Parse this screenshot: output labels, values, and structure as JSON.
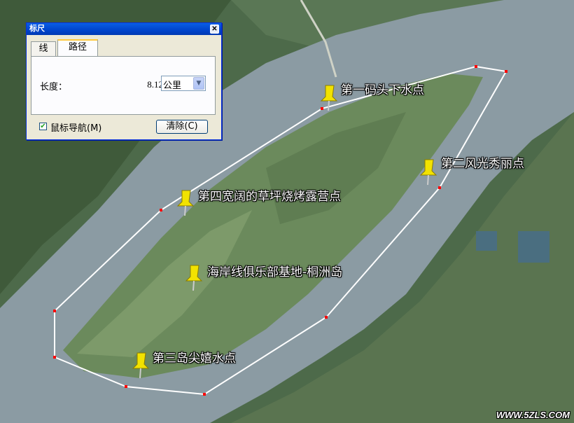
{
  "ruler_dialog": {
    "title": "标尺",
    "close_glyph": "✕",
    "tabs": [
      {
        "label": "线"
      },
      {
        "label": "路径"
      }
    ],
    "length_label": "长度：",
    "length_value": "8.12",
    "unit_selected": "公里",
    "dropdown_glyph": "▼",
    "mouse_nav_label": "鼠标导航(M)",
    "mouse_nav_checked": true,
    "check_glyph": "✔",
    "clear_button": "清除(C)"
  },
  "placemarks": [
    {
      "label": "第一码头下水点"
    },
    {
      "label": "第二风光秀丽点"
    },
    {
      "label": "第四宽阔的草坪烧烤露营点"
    },
    {
      "label": "海岸线俱乐部基地-桐洲岛"
    },
    {
      "label": "第三岛尖嬉水点"
    }
  ],
  "watermark": "WWW.5ZLS.COM",
  "colors": {
    "path_line": "#ffffff",
    "vertex": "#ff0000",
    "pin_yellow": "#f2e200",
    "river": "#8a9aa2"
  }
}
